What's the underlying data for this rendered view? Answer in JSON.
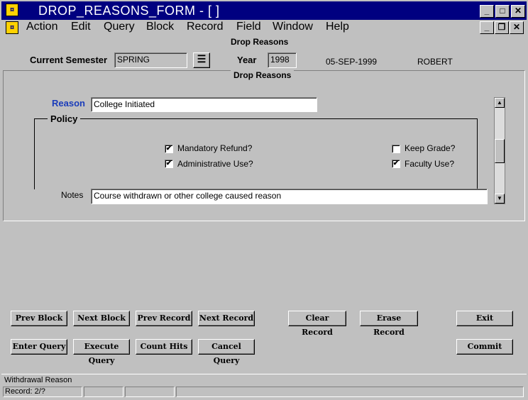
{
  "window": {
    "title": "DROP_REASONS_FORM - [ ]"
  },
  "menu": [
    "Action",
    "Edit",
    "Query",
    "Block",
    "Record",
    "Field",
    "Window",
    "Help"
  ],
  "header": {
    "form_title": "Drop Reasons",
    "semester_label": "Current Semester",
    "semester_value": "SPRING",
    "year_label": "Year",
    "year_value": "1998",
    "date": "05-SEP-1999",
    "user": "ROBERT"
  },
  "block": {
    "title": "Drop Reasons",
    "reason_label": "Reason",
    "reason_value": "College Initiated",
    "policy_label": "Policy",
    "mandatory_refund": {
      "label": "Mandatory Refund?",
      "checked": true
    },
    "administrative_use": {
      "label": "Administrative Use?",
      "checked": true
    },
    "keep_grade": {
      "label": "Keep Grade?",
      "checked": false
    },
    "faculty_use": {
      "label": "Faculty Use?",
      "checked": true
    },
    "notes_label": "Notes",
    "notes_value": "Course withdrawn or other college caused reason"
  },
  "buttons": {
    "prev_block": "Prev Block",
    "next_block": "Next Block",
    "prev_record": "Prev Record",
    "next_record": "Next Record",
    "clear_record": "Clear Record",
    "erase_record": "Erase Record",
    "exit": "Exit",
    "enter_query": "Enter Query",
    "execute_query": "Execute Query",
    "count_hits": "Count Hits",
    "cancel_query": "Cancel Query",
    "commit": "Commit"
  },
  "status": {
    "message": "Withdrawal Reason",
    "record": "Record: 2/?"
  },
  "check_glyph": "✔"
}
